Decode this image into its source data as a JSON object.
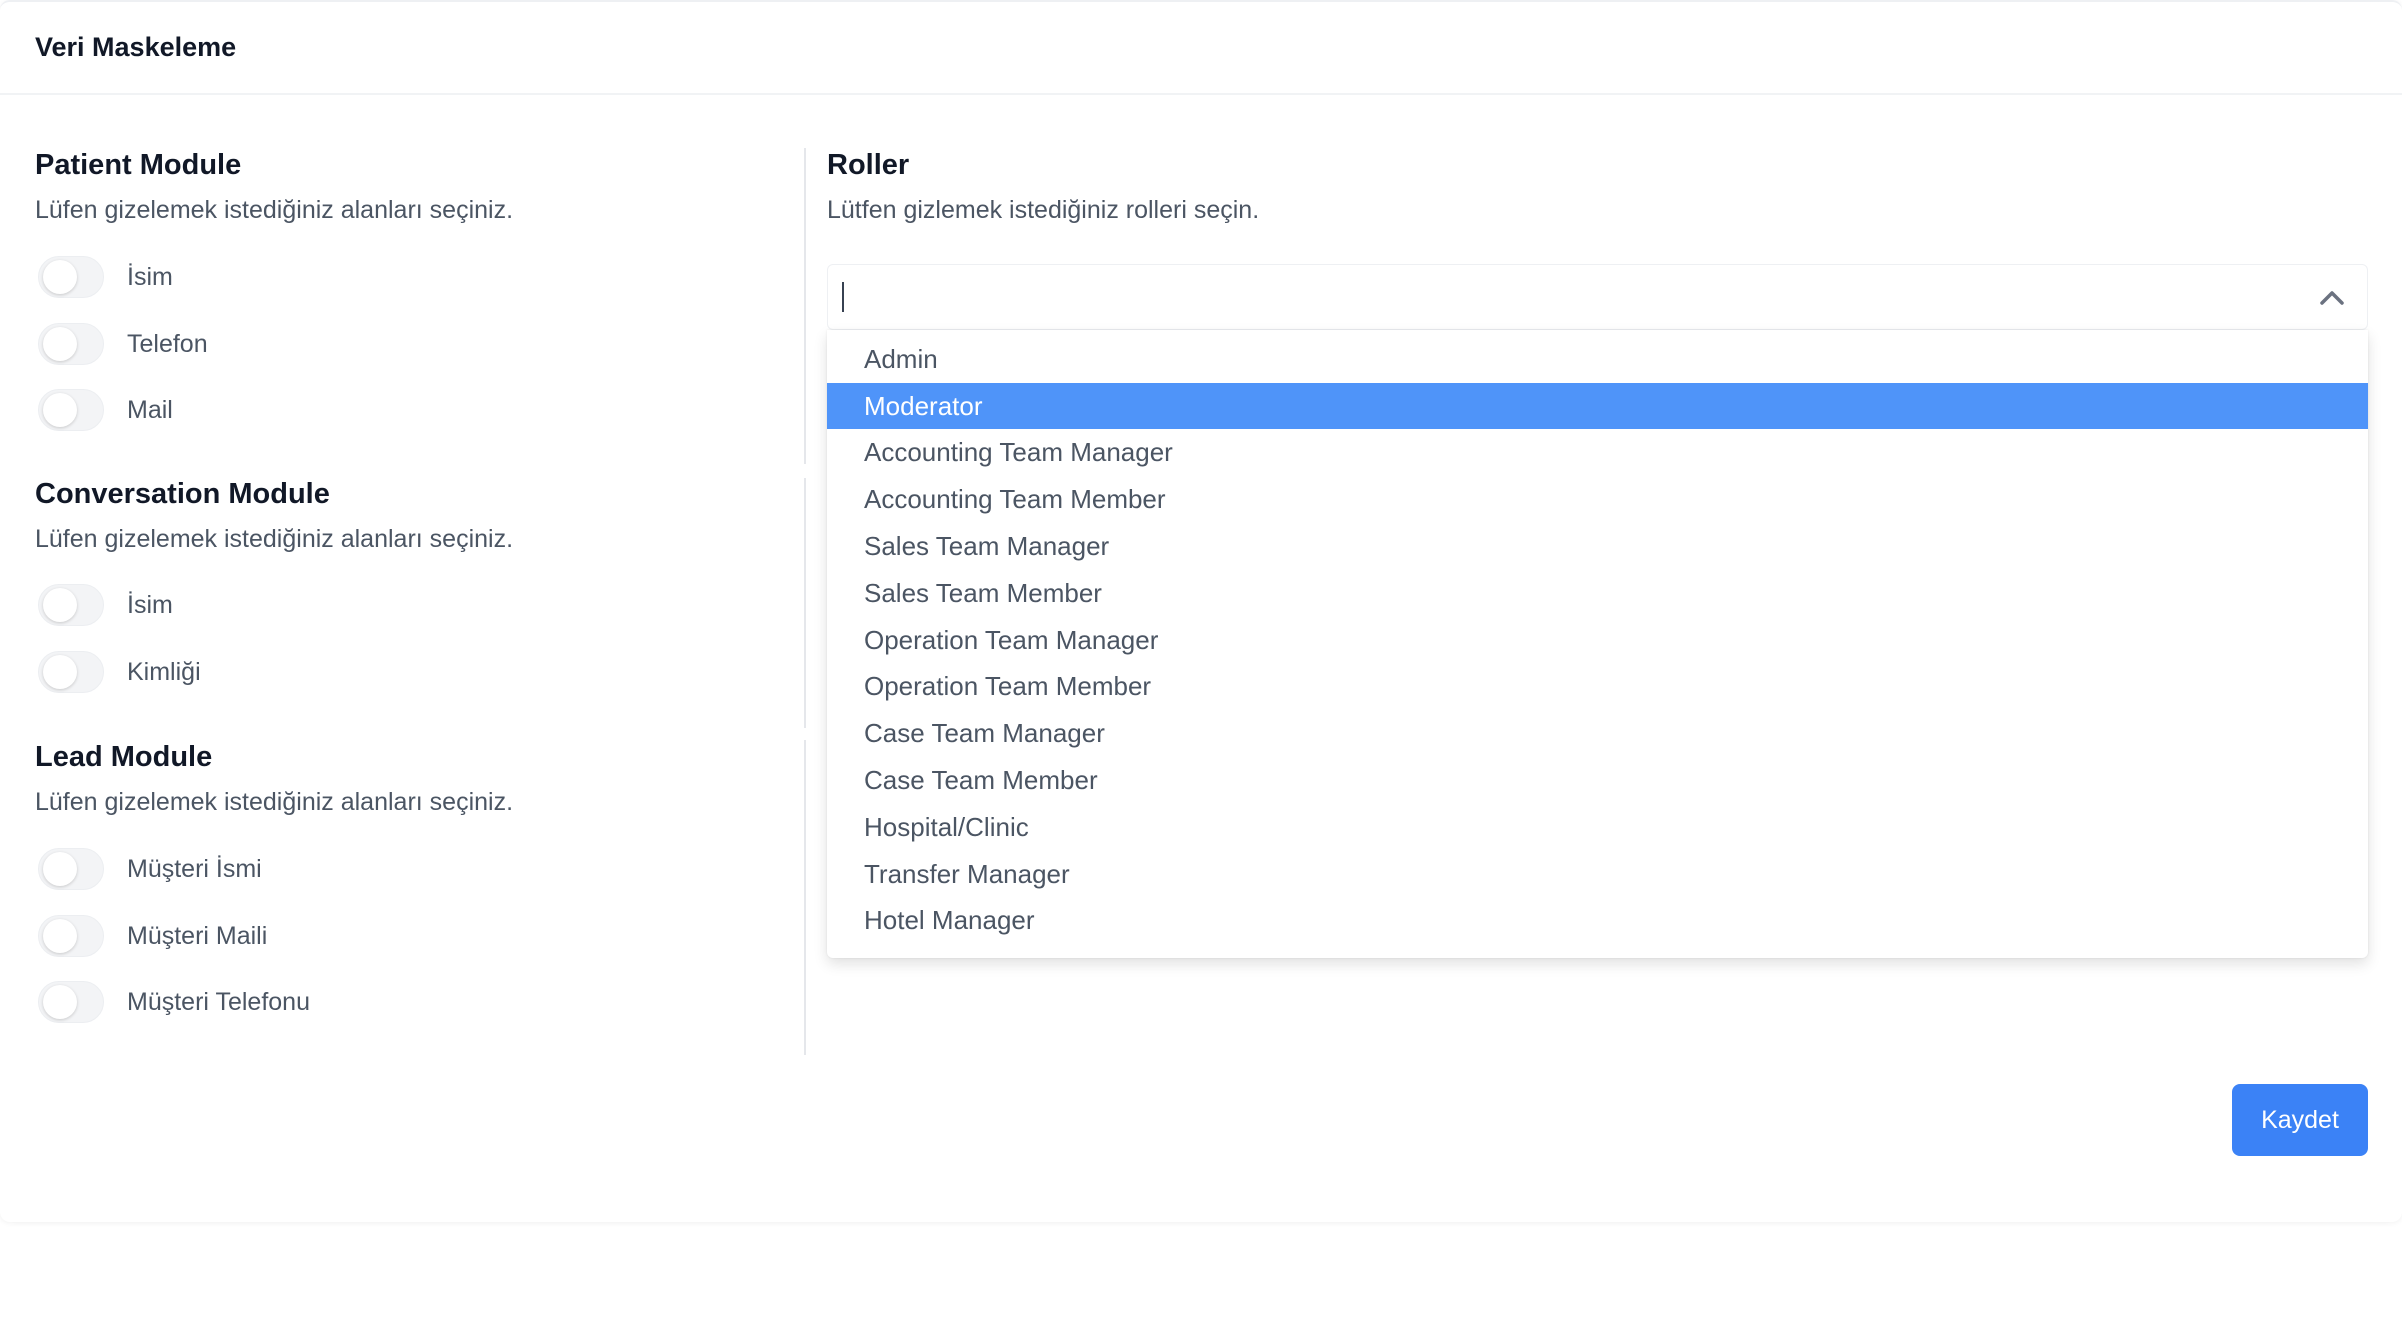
{
  "header": {
    "title": "Veri Maskeleme"
  },
  "modules": [
    {
      "title": "Patient Module",
      "description": "Lüfen gizelemek istediğiniz alanları seçiniz.",
      "fields": [
        {
          "label": "İsim",
          "checked": false
        },
        {
          "label": "Telefon",
          "checked": false
        },
        {
          "label": "Mail",
          "checked": false
        }
      ]
    },
    {
      "title": "Conversation Module",
      "description": "Lüfen gizelemek istediğiniz alanları seçiniz.",
      "fields": [
        {
          "label": "İsim",
          "checked": false
        },
        {
          "label": "Kimliği",
          "checked": false
        }
      ]
    },
    {
      "title": "Lead Module",
      "description": "Lüfen gizelemek istediğiniz alanları seçiniz.",
      "fields": [
        {
          "label": "Müşteri İsmi",
          "checked": false
        },
        {
          "label": "Müşteri Maili",
          "checked": false
        },
        {
          "label": "Müşteri Telefonu",
          "checked": false
        }
      ]
    }
  ],
  "roles": {
    "title": "Roller",
    "description": "Lütfen gizlemek istediğiniz rolleri seçin.",
    "search_value": "",
    "highlighted": "Moderator",
    "options": [
      "Admin",
      "Moderator",
      "Accounting Team Manager",
      "Accounting Team Member",
      "Sales Team Manager",
      "Sales Team Member",
      "Operation Team Manager",
      "Operation Team Member",
      "Case Team Manager",
      "Case Team Member",
      "Hospital/Clinic",
      "Transfer Manager",
      "Hotel Manager"
    ]
  },
  "actions": {
    "save_label": "Kaydet"
  },
  "colors": {
    "primary": "#3b82f6",
    "highlight": "#4f94f9",
    "muted_text": "#4b5563",
    "toggle_off": "#f3f4f6"
  }
}
